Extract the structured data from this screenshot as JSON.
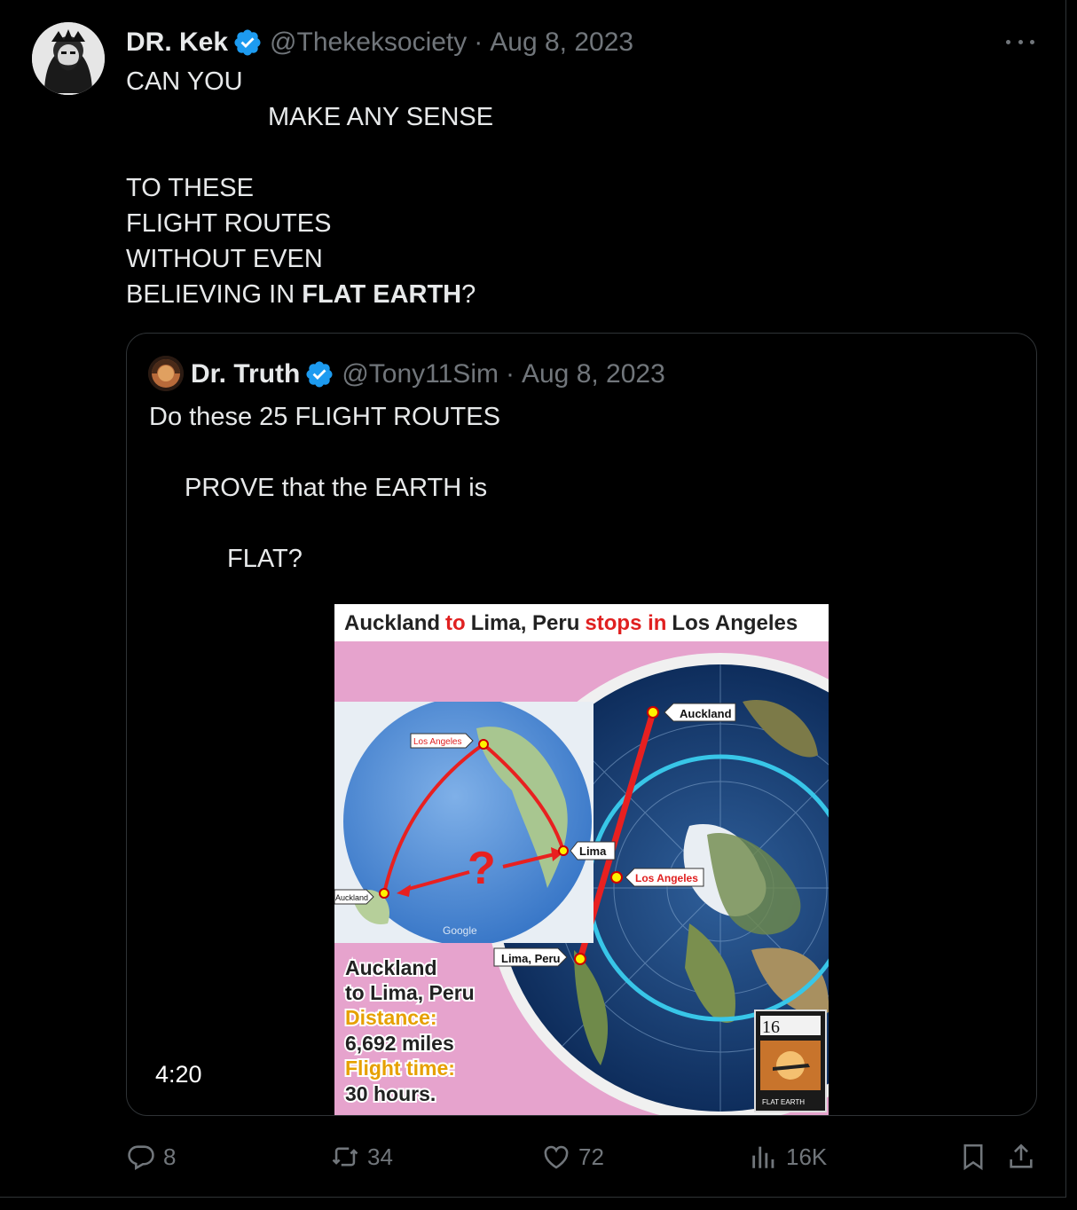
{
  "tweet": {
    "author_name": "DR. Kek",
    "handle": "@Thekeksociety",
    "date": "Aug 8, 2023",
    "text_lines": [
      {
        "text": "CAN YOU",
        "indent": 0
      },
      {
        "text": "MAKE ANY SENSE",
        "indent": 160
      },
      {
        "text": "",
        "indent": 0
      },
      {
        "text": "TO THESE",
        "indent": 0
      },
      {
        "text": "FLIGHT ROUTES",
        "indent": 0
      },
      {
        "text": "WITHOUT EVEN",
        "indent": 0
      }
    ],
    "last_line_pre": "BELIEVING IN ",
    "last_line_bold": "FLAT EARTH",
    "last_line_post": "?"
  },
  "quote": {
    "author_name": "Dr. Truth",
    "handle": "@Tony11Sim",
    "date": "Aug 8, 2023",
    "line1": "Do these 25 FLIGHT ROUTES",
    "line2": "PROVE that the EARTH is",
    "line3": "FLAT?",
    "video_duration": "4:20",
    "media": {
      "title_a": "Auckland",
      "title_to": "to",
      "title_b": "Lima, Peru",
      "title_stops": "stops in",
      "title_c": "Los Angeles",
      "label_auckland": "Auckland",
      "label_los_angeles": "Los Angeles",
      "label_lima": "Lima",
      "label_lima_peru": "Lima, Peru",
      "label_los_angeles_small": "Los Angeles",
      "label_auckland_small": "Auckland",
      "label_google": "Google",
      "info_line1": "Auckland",
      "info_line2": "to Lima, Peru",
      "info_distance_label": "Distance:",
      "info_distance_value": "6,692 miles",
      "info_time_label": "Flight time:",
      "info_time_value": "30 hours.",
      "badge_number": "16",
      "badge_caption": "FLAT EARTH"
    }
  },
  "actions": {
    "replies": "8",
    "retweets": "34",
    "likes": "72",
    "views": "16K"
  },
  "colors": {
    "background": "#000000",
    "text": "#e7e9ea",
    "muted": "#71767b",
    "verified": "#1d9bf0",
    "border": "#2f3336"
  }
}
